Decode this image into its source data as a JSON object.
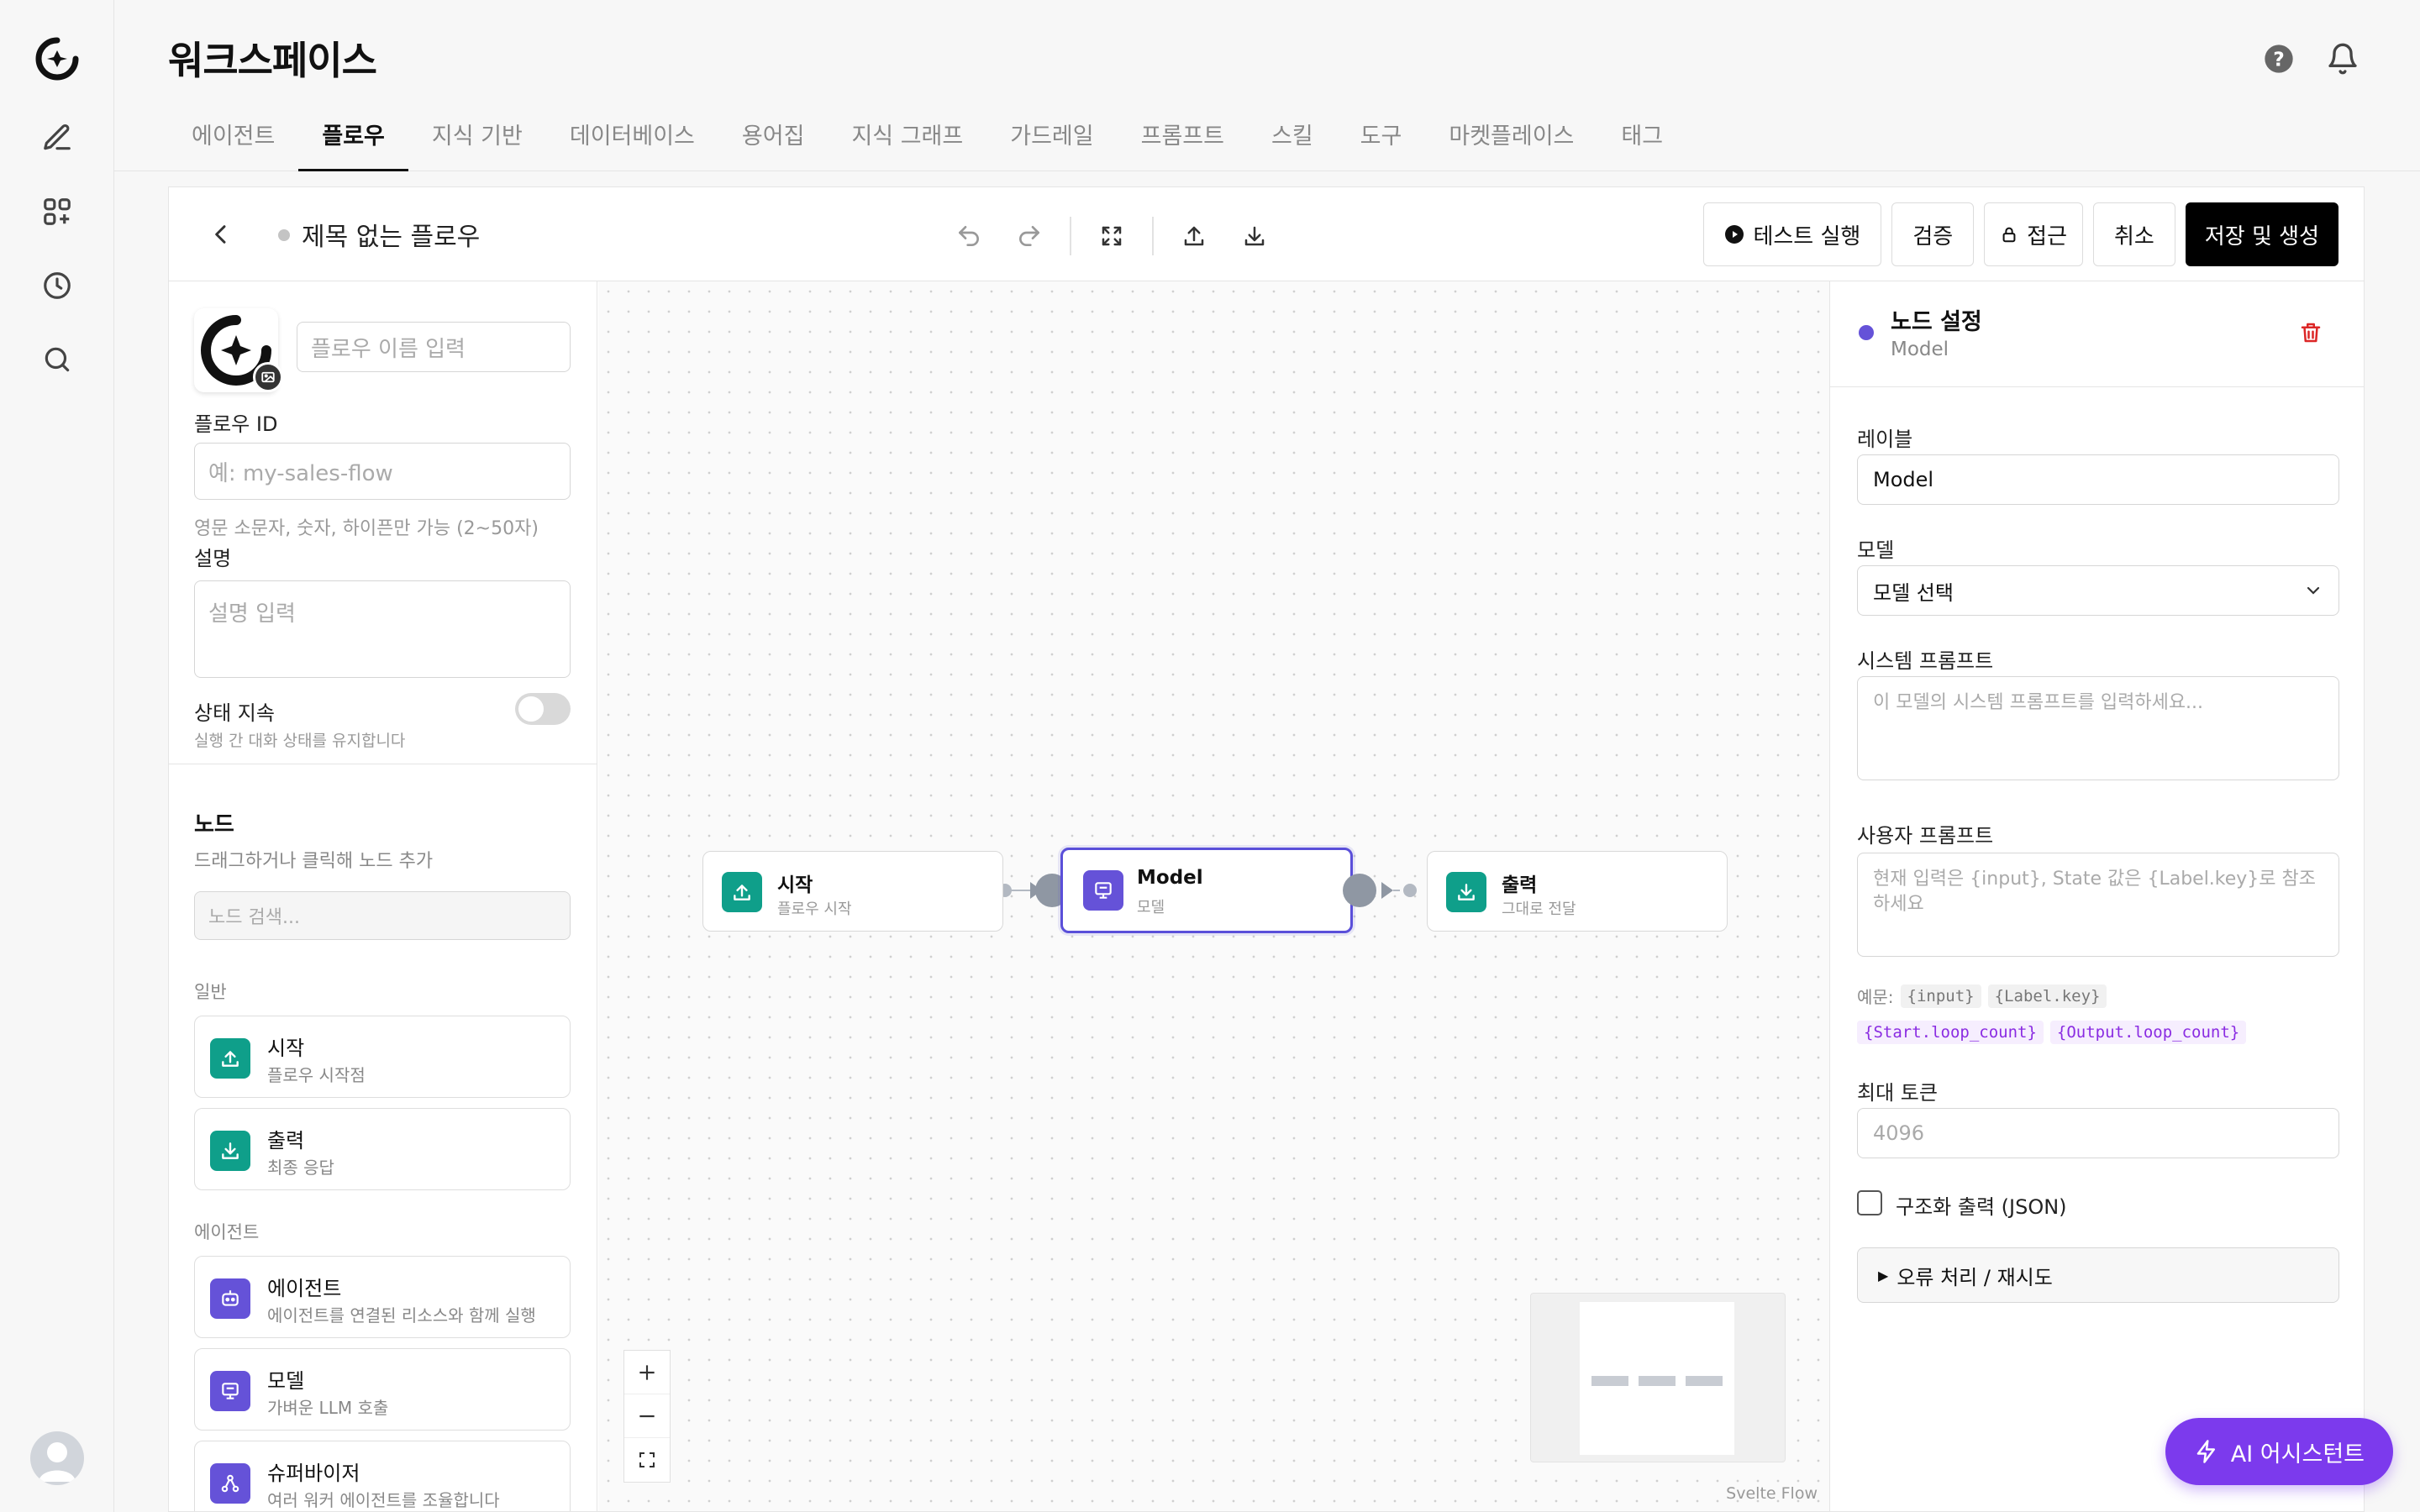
{
  "header": {
    "title": "워크스페이스",
    "tabs": [
      "에이전트",
      "플로우",
      "지식 기반",
      "데이터베이스",
      "용어집",
      "지식 그래프",
      "가드레일",
      "프롬프트",
      "스킬",
      "도구",
      "마켓플레이스",
      "태그"
    ],
    "active_tab": "플로우"
  },
  "toolbar": {
    "flow_title": "제목 없는 플로우",
    "test_run": "테스트 실행",
    "validate": "검증",
    "access": "접근",
    "cancel": "취소",
    "save_create": "저장 및 생성"
  },
  "left": {
    "name_placeholder": "플로우 이름 입력",
    "flow_id_label": "플로우 ID",
    "flow_id_placeholder": "예: my-sales-flow",
    "flow_id_hint": "영문 소문자, 숫자, 하이픈만 가능 (2~50자)",
    "desc_label": "설명",
    "desc_placeholder": "설명 입력",
    "state_label": "상태 지속",
    "state_hint": "실행 간 대화 상태를 유지합니다",
    "nodes_title": "노드",
    "nodes_hint": "드래그하거나 클릭해 노드 추가",
    "node_search_placeholder": "노드 검색...",
    "group_general": "일반",
    "group_agent": "에이전트",
    "items": [
      {
        "title": "시작",
        "sub": "플로우 시작점"
      },
      {
        "title": "출력",
        "sub": "최종 응답"
      },
      {
        "title": "에이전트",
        "sub": "에이전트를 연결된 리소스와 함께 실행"
      },
      {
        "title": "모델",
        "sub": "가벼운 LLM 호출"
      },
      {
        "title": "슈퍼바이저",
        "sub": "여러 워커 에이전트를 조율합니다"
      }
    ]
  },
  "canvas": {
    "nodes": [
      {
        "title": "시작",
        "sub": "플로우 시작"
      },
      {
        "title": "Model",
        "sub": "모델"
      },
      {
        "title": "출력",
        "sub": "그대로 전달"
      }
    ],
    "attribution": "Svelte Flow"
  },
  "right": {
    "title": "노드 설정",
    "subtitle": "Model",
    "label_label": "레이블",
    "label_value": "Model",
    "model_label": "모델",
    "model_value": "모델 선택",
    "system_prompt_label": "시스템 프롬프트",
    "system_prompt_placeholder": "이 모델의 시스템 프롬프트를 입력하세요...",
    "user_prompt_label": "사용자 프롬프트",
    "user_prompt_placeholder": "현재 입력은 {input}, State 값은 {Label.key}로 참조하세요",
    "example_label": "예문:",
    "example_codes": [
      "{input}",
      "{Label.key}"
    ],
    "example_codes_2": [
      "{Start.loop_count}",
      "{Output.loop_count}"
    ],
    "max_tokens_label": "최대 토큰",
    "max_tokens_placeholder": "4096",
    "structured_output_label": "구조화 출력 (JSON)",
    "error_handling_label": "오류 처리 / 재시도"
  },
  "ai_assistant": "AI 어시스턴트",
  "colors": {
    "accent": "#5a4fd9",
    "teal": "#0f9f8a",
    "purple": "#6552d8",
    "ai_button": "#7c3aed",
    "delete": "#dc2626"
  }
}
